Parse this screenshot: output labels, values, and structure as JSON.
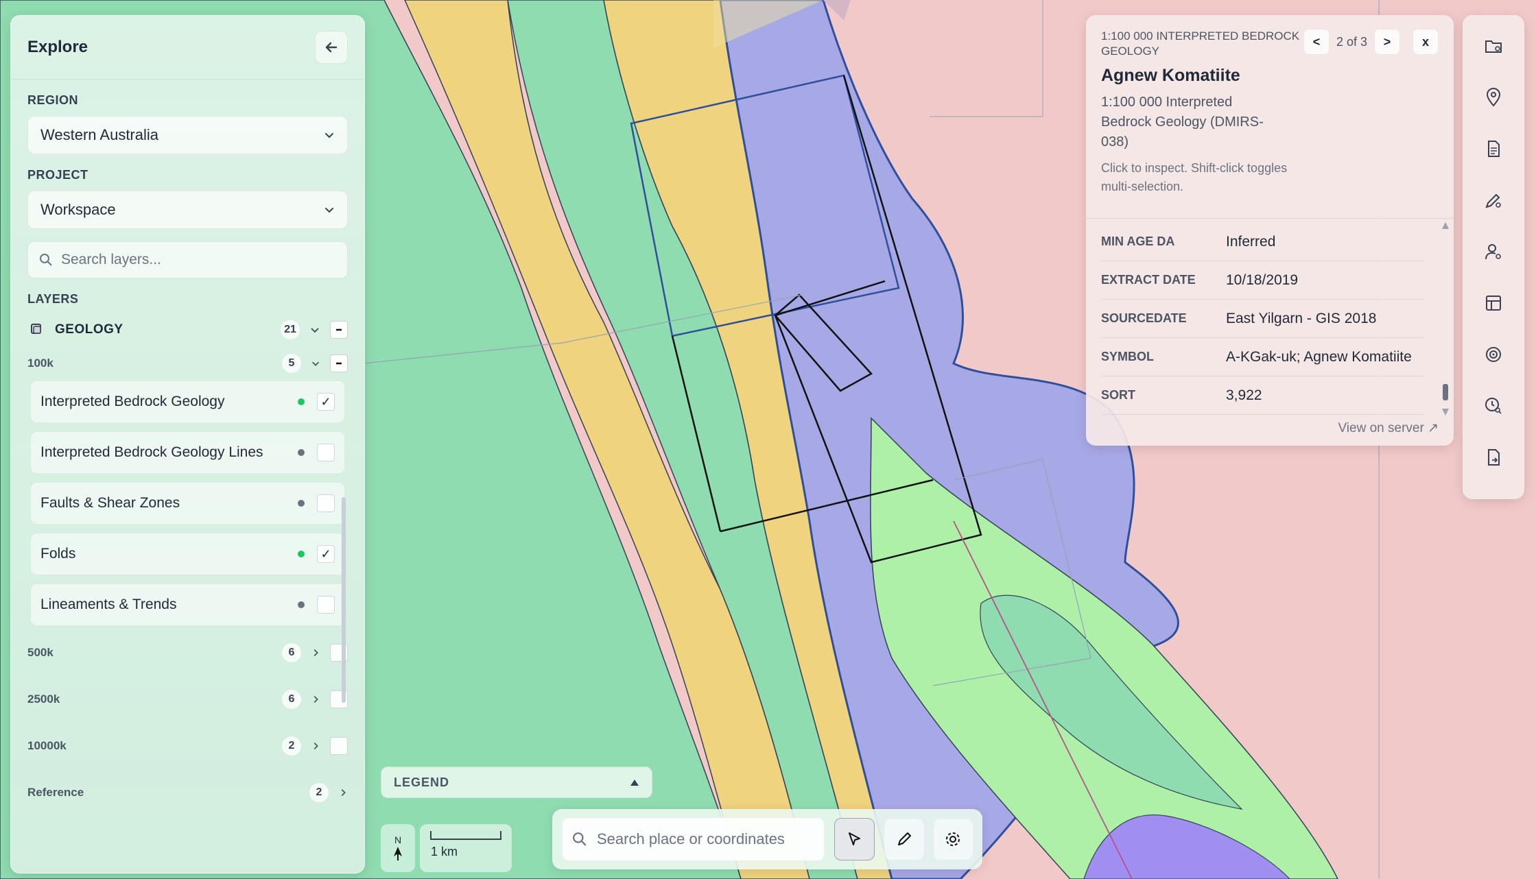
{
  "explore": {
    "title": "Explore",
    "region_label": "REGION",
    "region_value": "Western Australia",
    "project_label": "PROJECT",
    "project_value": "Workspace",
    "search_placeholder": "Search layers...",
    "layers_label": "LAYERS",
    "group": {
      "name": "GEOLOGY",
      "count": "21"
    },
    "subgroup_100k": {
      "name": "100k",
      "count": "5"
    },
    "layers": [
      {
        "label": "Interpreted Bedrock Geology",
        "status_color": "#22c55e",
        "checked": true
      },
      {
        "label": "Interpreted Bedrock Geology Lines",
        "status_color": "#6b7280",
        "checked": false
      },
      {
        "label": "Faults & Shear Zones",
        "status_color": "#6b7280",
        "checked": false
      },
      {
        "label": "Folds",
        "status_color": "#22c55e",
        "checked": true
      },
      {
        "label": "Lineaments & Trends",
        "status_color": "#6b7280",
        "checked": false
      }
    ],
    "collapsed_groups": [
      {
        "name": "500k",
        "count": "6"
      },
      {
        "name": "2500k",
        "count": "6"
      },
      {
        "name": "10000k",
        "count": "2"
      },
      {
        "name": "Reference",
        "count": "2"
      }
    ],
    "check_mark": "✓"
  },
  "legend": {
    "label": "LEGEND"
  },
  "north": {
    "label": "N"
  },
  "scale": {
    "label": "1 km"
  },
  "bottom": {
    "search_placeholder": "Search place or coordinates"
  },
  "info": {
    "kicker": "1:100 000 INTERPRETED BEDROCK GEOLOGY",
    "pager": "2 of 3",
    "prev": "<",
    "next": ">",
    "close": "x",
    "feature": "Agnew Komatiite",
    "subtitle": "1:100 000 Interpreted Bedrock Geology (DMIRS-038)",
    "hint": "Click to inspect. Shift-click toggles multi-selection.",
    "properties": [
      {
        "key": "MIN AGE DA",
        "value": "Inferred"
      },
      {
        "key": "EXTRACT DATE",
        "value": "10/18/2019"
      },
      {
        "key": "SOURCEDATE",
        "value": "East Yilgarn - GIS 2018"
      },
      {
        "key": "SYMBOL",
        "value": "A-KGak-uk; Agnew Komatiite"
      },
      {
        "key": "SORT",
        "value": "3,922"
      }
    ],
    "view_server": "View on server ↗"
  },
  "colors": {
    "green": "#8fdcb0",
    "yellow": "#efd37f",
    "blue": "#a7a8e6",
    "pink": "#f2c9c9",
    "light_green": "#aef0a8"
  }
}
